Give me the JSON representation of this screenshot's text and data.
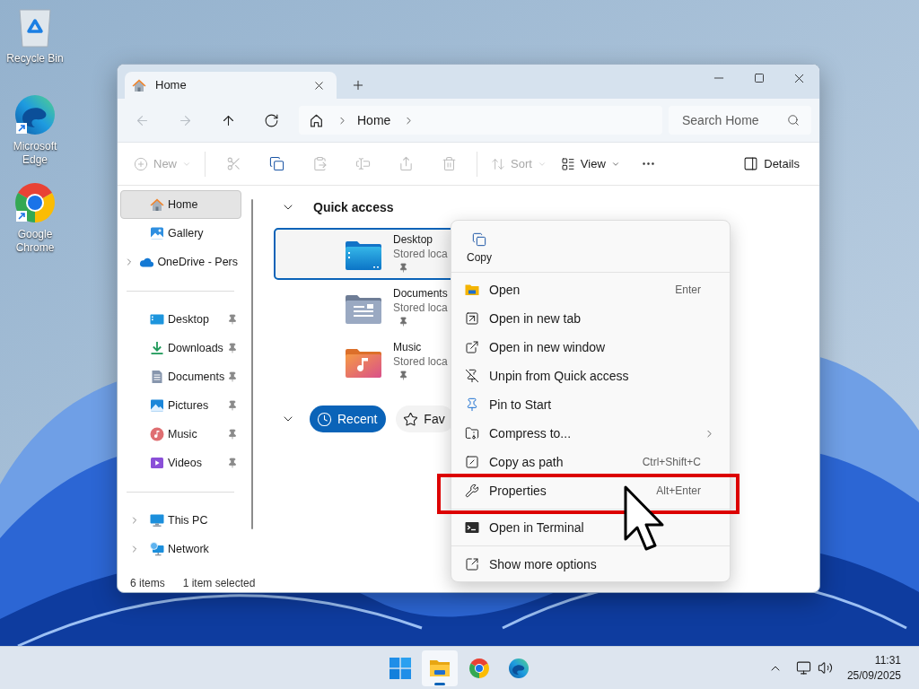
{
  "desktop_icons": [
    {
      "label": "Recycle Bin",
      "kind": "recycle-bin"
    },
    {
      "label": "Microsoft Edge",
      "kind": "edge"
    },
    {
      "label": "Google Chrome",
      "kind": "chrome"
    }
  ],
  "explorer": {
    "tabs": [
      {
        "label": "Home",
        "selected": true
      }
    ],
    "nav_buttons": [
      {
        "kind": "back",
        "disabled": true
      },
      {
        "kind": "forward",
        "disabled": true
      },
      {
        "kind": "up",
        "disabled": false
      },
      {
        "kind": "refresh",
        "disabled": false
      }
    ],
    "address": {
      "segments": [
        "Home"
      ]
    },
    "search": {
      "placeholder": "Search Home"
    },
    "toolbar": {
      "groups": [
        [
          {
            "kind": "new",
            "label": "New",
            "disabled": true
          }
        ],
        [
          {
            "kind": "cut",
            "disabled": true
          },
          {
            "kind": "copy",
            "disabled": false
          },
          {
            "kind": "paste",
            "disabled": true
          },
          {
            "kind": "rename",
            "disabled": true
          },
          {
            "kind": "share",
            "disabled": true
          },
          {
            "kind": "delete",
            "disabled": true
          }
        ],
        [
          {
            "kind": "sort",
            "label": "Sort",
            "disabled": true
          },
          {
            "kind": "view",
            "label": "View",
            "disabled": false
          },
          {
            "kind": "more",
            "disabled": false
          }
        ]
      ],
      "details": {
        "label": "Details"
      }
    },
    "sidebar": {
      "sections": [
        {
          "items": [
            {
              "label": "Home",
              "kind": "home",
              "selected": true
            },
            {
              "label": "Gallery",
              "kind": "gallery",
              "selected": false
            },
            {
              "label": "OneDrive - Pers",
              "kind": "onedrive",
              "selected": false,
              "expanded": false
            }
          ]
        },
        {
          "items": [
            {
              "label": "Desktop",
              "kind": "desktop",
              "selected": false,
              "pinned": true
            },
            {
              "label": "Downloads",
              "kind": "downloads",
              "selected": false,
              "pinned": true
            },
            {
              "label": "Documents",
              "kind": "documents",
              "selected": false,
              "pinned": true
            },
            {
              "label": "Pictures",
              "kind": "pictures",
              "selected": false,
              "pinned": true
            },
            {
              "label": "Music",
              "kind": "music",
              "selected": false,
              "pinned": true
            },
            {
              "label": "Videos",
              "kind": "videos",
              "selected": false,
              "pinned": true
            }
          ]
        },
        {
          "items": [
            {
              "label": "This PC",
              "kind": "this-pc",
              "selected": false,
              "expanded": false
            },
            {
              "label": "Network",
              "kind": "network",
              "selected": false,
              "expanded": false
            }
          ]
        }
      ]
    },
    "quick_access": {
      "title": "Quick access",
      "expanded": true,
      "items": [
        {
          "name": "Desktop",
          "detail": "Stored loca",
          "kind": "desktop",
          "selected": true,
          "pinned": true
        },
        {
          "name": "Documents",
          "detail": "Stored loca",
          "kind": "documents",
          "selected": false,
          "pinned": true
        },
        {
          "name": "Music",
          "detail": "Stored loca",
          "kind": "music",
          "selected": false,
          "pinned": true
        }
      ]
    },
    "recent_bar": {
      "expanded": true,
      "tabs": [
        {
          "label": "Recent",
          "kind": "recent",
          "selected": true
        },
        {
          "label": "Fav",
          "kind": "favorites",
          "selected": false
        }
      ]
    },
    "status_bar": {
      "count": "6 items",
      "selection": "1 item selected"
    }
  },
  "context_menu": {
    "top_actions": [
      {
        "label": "Copy",
        "kind": "copy"
      }
    ],
    "groups": [
      [
        {
          "label": "Open",
          "kind": "open",
          "shortcut": "Enter",
          "highlighted": false
        },
        {
          "label": "Open in new tab",
          "kind": "new-tab",
          "highlighted": false
        },
        {
          "label": "Open in new window",
          "kind": "new-window",
          "highlighted": false
        },
        {
          "label": "Unpin from Quick access",
          "kind": "unpin",
          "highlighted": false
        },
        {
          "label": "Pin to Start",
          "kind": "pin",
          "highlighted": false
        },
        {
          "label": "Compress to...",
          "kind": "compress",
          "submenu": true,
          "highlighted": false
        },
        {
          "label": "Copy as path",
          "kind": "copy-path",
          "shortcut": "Ctrl+Shift+C",
          "highlighted": false
        },
        {
          "label": "Properties",
          "kind": "properties",
          "shortcut": "Alt+Enter",
          "highlighted": true
        }
      ],
      [
        {
          "label": "Open in Terminal",
          "kind": "terminal",
          "highlighted": false
        }
      ],
      [
        {
          "label": "Show more options",
          "kind": "more-options",
          "highlighted": false
        }
      ]
    ]
  },
  "taskbar": {
    "apps": [
      {
        "kind": "start",
        "active": false
      },
      {
        "kind": "explorer",
        "active": true
      },
      {
        "kind": "chrome",
        "active": false
      },
      {
        "kind": "edge",
        "active": false
      }
    ],
    "tray": {
      "time": "11:31",
      "date": "25/09/2025"
    }
  }
}
